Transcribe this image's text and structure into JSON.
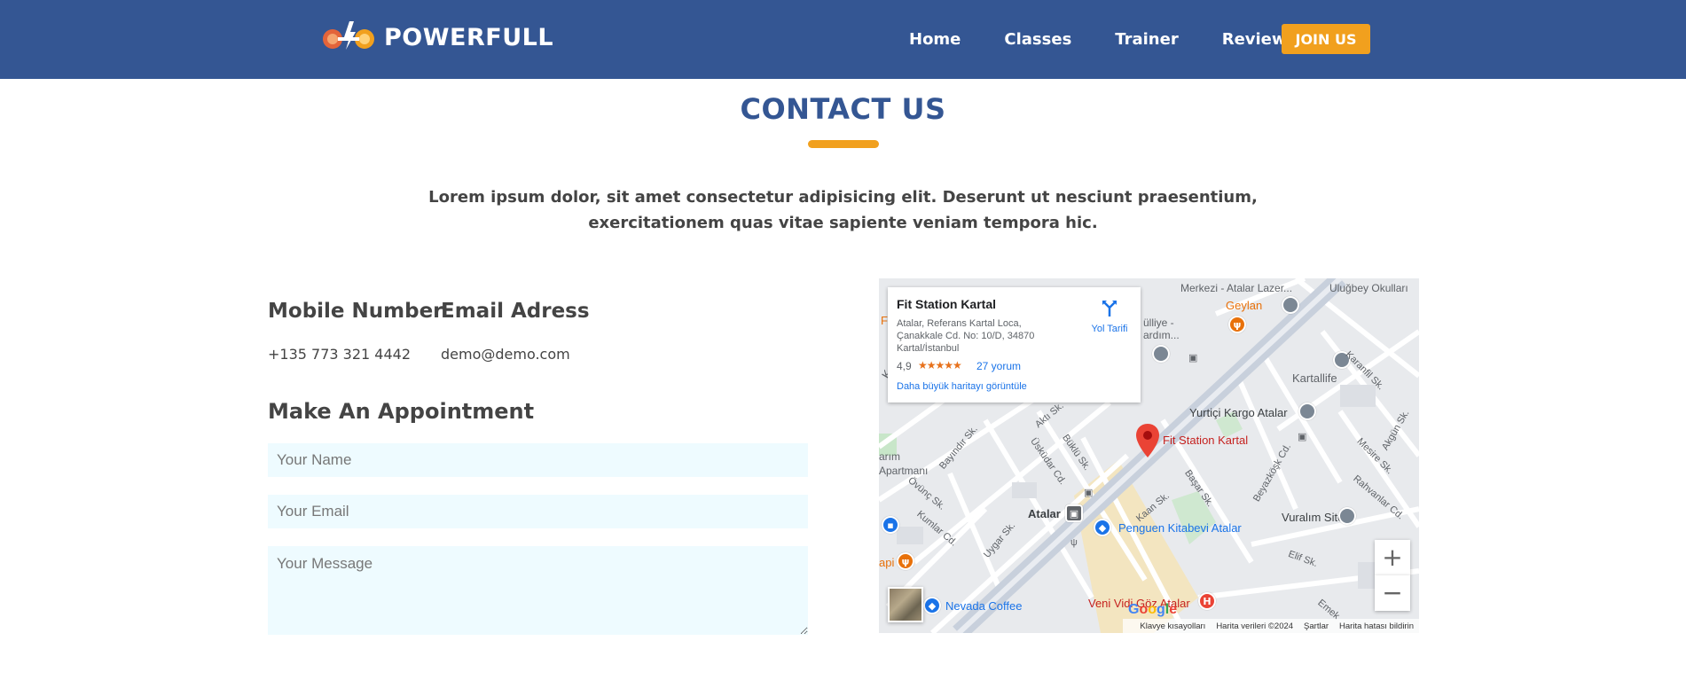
{
  "brand": {
    "name": "POWERFULL",
    "logo_icon": "barbell-lightning-logo"
  },
  "nav": {
    "items": [
      {
        "label": "Home"
      },
      {
        "label": "Classes"
      },
      {
        "label": "Trainer"
      },
      {
        "label": "Review"
      }
    ],
    "cta_label": "JOIN US"
  },
  "contact": {
    "title": "CONTACT US",
    "lead": "Lorem ipsum dolor, sit amet consectetur adipisicing elit. Deserunt ut nesciunt praesentium, exercitationem quas vitae sapiente veniam tempora hic.",
    "mobile_heading": "Mobile Number",
    "mobile_value": "+135 773 321 4442",
    "email_heading": "Email Adress",
    "email_value": "demo@demo.com",
    "appointment_heading": "Make An Appointment",
    "form": {
      "name_placeholder": "Your Name",
      "email_placeholder": "Your Email",
      "message_placeholder": "Your Message"
    }
  },
  "map": {
    "card": {
      "place_name": "Fit Station Kartal",
      "address": "Atalar, Referans Kartal Loca, Çanakkale Cd. No: 10/D, 34870 Kartal/İstanbul",
      "rating": "4,9",
      "stars": "★★★★★",
      "reviews": "27 yorum",
      "directions": "Yol Tarifi",
      "larger_map": "Daha büyük haritayı görüntüle"
    },
    "labels": {
      "merkezi": "Merkezi - Atalar Lazer...",
      "ulugbey": "Uluğbey Okulları",
      "geylan": "Geylan",
      "mulliye": "ülliye -",
      "yardim": "ardım...",
      "kartallife": "Kartallife",
      "karanfil": "Karanfil Sk.",
      "yurtici": "Yurtiçi Kargo Atalar",
      "akgun": "Akgün Sk.",
      "fit_station": "Fit Station Kartal",
      "mesire": "Mesire Sk.",
      "rahvanlar": "Rahvanlar Cd.",
      "beyazkosk": "Beyazköşk Cd.",
      "basar": "Başar Sk.",
      "kaan": "Kaan Sk.",
      "uskudar": "Üsküdar Cd.",
      "buklu": "Büklü Sk.",
      "akti": "Aktı Sk.",
      "bayindir": "Bayındır Sk.",
      "apartmani": "Apartmanı",
      "arim": "arım",
      "ovunc": "Övünç Sk.",
      "kumlar": "Kumlar Cd.",
      "uygar": "Uygar Sk.",
      "atalar": "Atalar",
      "penguen": "Penguen Kitabevi Atalar",
      "vuralim": "Vuralım Sitesi",
      "elif": "Elif Sk.",
      "emek": "Emek",
      "api": "api",
      "nevada": "Nevada Coffee",
      "veni_vidi": "Veni Vidi Göz Atalar",
      "letter_f": "F",
      "letter_k": "K"
    },
    "google": "Google",
    "attribution": {
      "keyboard": "Klavye kısayolları",
      "data": "Harita verileri ©2024",
      "terms": "Şartlar",
      "report": "Harita hatası bildirin"
    },
    "zoom_in": "+",
    "zoom_out": "−"
  },
  "colors": {
    "navbar": "#345693",
    "accent": "#f1a01e",
    "title": "#345693",
    "text": "#444444",
    "field_bg": "#eefbff"
  }
}
